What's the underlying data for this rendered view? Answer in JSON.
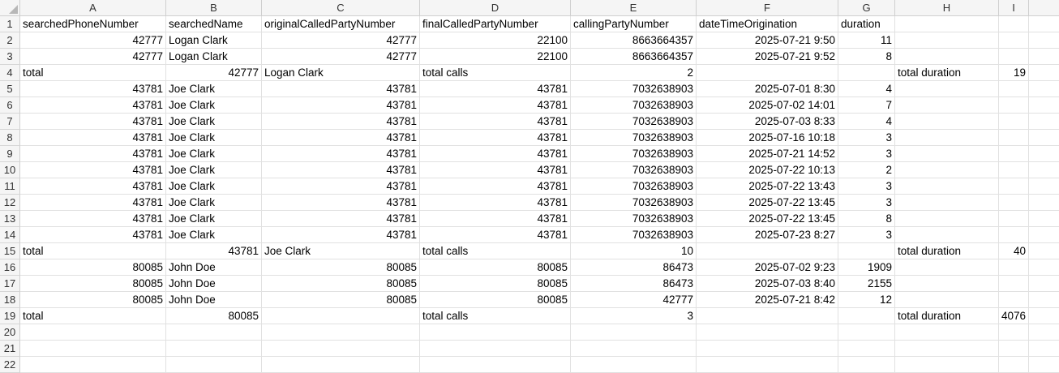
{
  "sheet": {
    "columns": [
      "A",
      "B",
      "C",
      "D",
      "E",
      "F",
      "G",
      "H",
      "I"
    ],
    "rows": [
      [
        {
          "v": "searchedPhoneNumber",
          "t": "s"
        },
        {
          "v": "searchedName",
          "t": "s"
        },
        {
          "v": "originalCalledPartyNumber",
          "t": "s"
        },
        {
          "v": "finalCalledPartyNumber",
          "t": "s"
        },
        {
          "v": "callingPartyNumber",
          "t": "s"
        },
        {
          "v": "dateTimeOrigination",
          "t": "s"
        },
        {
          "v": "duration",
          "t": "s"
        },
        {
          "v": "",
          "t": "s"
        },
        {
          "v": "",
          "t": "s"
        }
      ],
      [
        {
          "v": "42777",
          "t": "n"
        },
        {
          "v": "Logan Clark",
          "t": "s"
        },
        {
          "v": "42777",
          "t": "n"
        },
        {
          "v": "22100",
          "t": "n"
        },
        {
          "v": "8663664357",
          "t": "n"
        },
        {
          "v": "2025-07-21 9:50",
          "t": "n"
        },
        {
          "v": "11",
          "t": "n"
        },
        {
          "v": "",
          "t": "s"
        },
        {
          "v": "",
          "t": "s"
        }
      ],
      [
        {
          "v": "42777",
          "t": "n"
        },
        {
          "v": "Logan Clark",
          "t": "s"
        },
        {
          "v": "42777",
          "t": "n"
        },
        {
          "v": "22100",
          "t": "n"
        },
        {
          "v": "8663664357",
          "t": "n"
        },
        {
          "v": "2025-07-21 9:52",
          "t": "n"
        },
        {
          "v": "8",
          "t": "n"
        },
        {
          "v": "",
          "t": "s"
        },
        {
          "v": "",
          "t": "s"
        }
      ],
      [
        {
          "v": "total",
          "t": "s"
        },
        {
          "v": "42777",
          "t": "n"
        },
        {
          "v": "Logan Clark",
          "t": "s"
        },
        {
          "v": "total calls",
          "t": "s"
        },
        {
          "v": "2",
          "t": "n"
        },
        {
          "v": "",
          "t": "s"
        },
        {
          "v": "",
          "t": "s"
        },
        {
          "v": "total duration",
          "t": "s"
        },
        {
          "v": "19",
          "t": "n"
        }
      ],
      [
        {
          "v": "43781",
          "t": "n"
        },
        {
          "v": "Joe Clark",
          "t": "s"
        },
        {
          "v": "43781",
          "t": "n"
        },
        {
          "v": "43781",
          "t": "n"
        },
        {
          "v": "7032638903",
          "t": "n"
        },
        {
          "v": "2025-07-01 8:30",
          "t": "n"
        },
        {
          "v": "4",
          "t": "n"
        },
        {
          "v": "",
          "t": "s"
        },
        {
          "v": "",
          "t": "s"
        }
      ],
      [
        {
          "v": "43781",
          "t": "n"
        },
        {
          "v": "Joe Clark",
          "t": "s"
        },
        {
          "v": "43781",
          "t": "n"
        },
        {
          "v": "43781",
          "t": "n"
        },
        {
          "v": "7032638903",
          "t": "n"
        },
        {
          "v": "2025-07-02 14:01",
          "t": "n"
        },
        {
          "v": "7",
          "t": "n"
        },
        {
          "v": "",
          "t": "s"
        },
        {
          "v": "",
          "t": "s"
        }
      ],
      [
        {
          "v": "43781",
          "t": "n"
        },
        {
          "v": "Joe Clark",
          "t": "s"
        },
        {
          "v": "43781",
          "t": "n"
        },
        {
          "v": "43781",
          "t": "n"
        },
        {
          "v": "7032638903",
          "t": "n"
        },
        {
          "v": "2025-07-03 8:33",
          "t": "n"
        },
        {
          "v": "4",
          "t": "n"
        },
        {
          "v": "",
          "t": "s"
        },
        {
          "v": "",
          "t": "s"
        }
      ],
      [
        {
          "v": "43781",
          "t": "n"
        },
        {
          "v": "Joe Clark",
          "t": "s"
        },
        {
          "v": "43781",
          "t": "n"
        },
        {
          "v": "43781",
          "t": "n"
        },
        {
          "v": "7032638903",
          "t": "n"
        },
        {
          "v": "2025-07-16 10:18",
          "t": "n"
        },
        {
          "v": "3",
          "t": "n"
        },
        {
          "v": "",
          "t": "s"
        },
        {
          "v": "",
          "t": "s"
        }
      ],
      [
        {
          "v": "43781",
          "t": "n"
        },
        {
          "v": "Joe Clark",
          "t": "s"
        },
        {
          "v": "43781",
          "t": "n"
        },
        {
          "v": "43781",
          "t": "n"
        },
        {
          "v": "7032638903",
          "t": "n"
        },
        {
          "v": "2025-07-21 14:52",
          "t": "n"
        },
        {
          "v": "3",
          "t": "n"
        },
        {
          "v": "",
          "t": "s"
        },
        {
          "v": "",
          "t": "s"
        }
      ],
      [
        {
          "v": "43781",
          "t": "n"
        },
        {
          "v": "Joe Clark",
          "t": "s"
        },
        {
          "v": "43781",
          "t": "n"
        },
        {
          "v": "43781",
          "t": "n"
        },
        {
          "v": "7032638903",
          "t": "n"
        },
        {
          "v": "2025-07-22 10:13",
          "t": "n"
        },
        {
          "v": "2",
          "t": "n"
        },
        {
          "v": "",
          "t": "s"
        },
        {
          "v": "",
          "t": "s"
        }
      ],
      [
        {
          "v": "43781",
          "t": "n"
        },
        {
          "v": "Joe Clark",
          "t": "s"
        },
        {
          "v": "43781",
          "t": "n"
        },
        {
          "v": "43781",
          "t": "n"
        },
        {
          "v": "7032638903",
          "t": "n"
        },
        {
          "v": "2025-07-22 13:43",
          "t": "n"
        },
        {
          "v": "3",
          "t": "n"
        },
        {
          "v": "",
          "t": "s"
        },
        {
          "v": "",
          "t": "s"
        }
      ],
      [
        {
          "v": "43781",
          "t": "n"
        },
        {
          "v": "Joe Clark",
          "t": "s"
        },
        {
          "v": "43781",
          "t": "n"
        },
        {
          "v": "43781",
          "t": "n"
        },
        {
          "v": "7032638903",
          "t": "n"
        },
        {
          "v": "2025-07-22 13:45",
          "t": "n"
        },
        {
          "v": "3",
          "t": "n"
        },
        {
          "v": "",
          "t": "s"
        },
        {
          "v": "",
          "t": "s"
        }
      ],
      [
        {
          "v": "43781",
          "t": "n"
        },
        {
          "v": "Joe Clark",
          "t": "s"
        },
        {
          "v": "43781",
          "t": "n"
        },
        {
          "v": "43781",
          "t": "n"
        },
        {
          "v": "7032638903",
          "t": "n"
        },
        {
          "v": "2025-07-22 13:45",
          "t": "n"
        },
        {
          "v": "8",
          "t": "n"
        },
        {
          "v": "",
          "t": "s"
        },
        {
          "v": "",
          "t": "s"
        }
      ],
      [
        {
          "v": "43781",
          "t": "n"
        },
        {
          "v": "Joe Clark",
          "t": "s"
        },
        {
          "v": "43781",
          "t": "n"
        },
        {
          "v": "43781",
          "t": "n"
        },
        {
          "v": "7032638903",
          "t": "n"
        },
        {
          "v": "2025-07-23 8:27",
          "t": "n"
        },
        {
          "v": "3",
          "t": "n"
        },
        {
          "v": "",
          "t": "s"
        },
        {
          "v": "",
          "t": "s"
        }
      ],
      [
        {
          "v": "total",
          "t": "s"
        },
        {
          "v": "43781",
          "t": "n"
        },
        {
          "v": "Joe Clark",
          "t": "s"
        },
        {
          "v": "total calls",
          "t": "s"
        },
        {
          "v": "10",
          "t": "n"
        },
        {
          "v": "",
          "t": "s"
        },
        {
          "v": "",
          "t": "s"
        },
        {
          "v": "total duration",
          "t": "s"
        },
        {
          "v": "40",
          "t": "n"
        }
      ],
      [
        {
          "v": "80085",
          "t": "n"
        },
        {
          "v": "John Doe",
          "t": "s"
        },
        {
          "v": "80085",
          "t": "n"
        },
        {
          "v": "80085",
          "t": "n"
        },
        {
          "v": "86473",
          "t": "n"
        },
        {
          "v": "2025-07-02 9:23",
          "t": "n"
        },
        {
          "v": "1909",
          "t": "n"
        },
        {
          "v": "",
          "t": "s"
        },
        {
          "v": "",
          "t": "s"
        }
      ],
      [
        {
          "v": "80085",
          "t": "n"
        },
        {
          "v": "John Doe",
          "t": "s"
        },
        {
          "v": "80085",
          "t": "n"
        },
        {
          "v": "80085",
          "t": "n"
        },
        {
          "v": "86473",
          "t": "n"
        },
        {
          "v": "2025-07-03 8:40",
          "t": "n"
        },
        {
          "v": "2155",
          "t": "n"
        },
        {
          "v": "",
          "t": "s"
        },
        {
          "v": "",
          "t": "s"
        }
      ],
      [
        {
          "v": "80085",
          "t": "n"
        },
        {
          "v": "John Doe",
          "t": "s"
        },
        {
          "v": "80085",
          "t": "n"
        },
        {
          "v": "80085",
          "t": "n"
        },
        {
          "v": "42777",
          "t": "n"
        },
        {
          "v": "2025-07-21 8:42",
          "t": "n"
        },
        {
          "v": "12",
          "t": "n"
        },
        {
          "v": "",
          "t": "s"
        },
        {
          "v": "",
          "t": "s"
        }
      ],
      [
        {
          "v": "total",
          "t": "s"
        },
        {
          "v": "80085",
          "t": "n"
        },
        {
          "v": "",
          "t": "s"
        },
        {
          "v": "total calls",
          "t": "s"
        },
        {
          "v": "3",
          "t": "n"
        },
        {
          "v": "",
          "t": "s"
        },
        {
          "v": "",
          "t": "s"
        },
        {
          "v": "total duration",
          "t": "s"
        },
        {
          "v": "4076",
          "t": "n"
        }
      ],
      [
        {
          "v": "",
          "t": "s"
        },
        {
          "v": "",
          "t": "s"
        },
        {
          "v": "",
          "t": "s"
        },
        {
          "v": "",
          "t": "s"
        },
        {
          "v": "",
          "t": "s"
        },
        {
          "v": "",
          "t": "s"
        },
        {
          "v": "",
          "t": "s"
        },
        {
          "v": "",
          "t": "s"
        },
        {
          "v": "",
          "t": "s"
        }
      ],
      [
        {
          "v": "",
          "t": "s"
        },
        {
          "v": "",
          "t": "s"
        },
        {
          "v": "",
          "t": "s"
        },
        {
          "v": "",
          "t": "s"
        },
        {
          "v": "",
          "t": "s"
        },
        {
          "v": "",
          "t": "s"
        },
        {
          "v": "",
          "t": "s"
        },
        {
          "v": "",
          "t": "s"
        },
        {
          "v": "",
          "t": "s"
        }
      ],
      [
        {
          "v": "",
          "t": "s"
        },
        {
          "v": "",
          "t": "s"
        },
        {
          "v": "",
          "t": "s"
        },
        {
          "v": "",
          "t": "s"
        },
        {
          "v": "",
          "t": "s"
        },
        {
          "v": "",
          "t": "s"
        },
        {
          "v": "",
          "t": "s"
        },
        {
          "v": "",
          "t": "s"
        },
        {
          "v": "",
          "t": "s"
        }
      ]
    ]
  }
}
